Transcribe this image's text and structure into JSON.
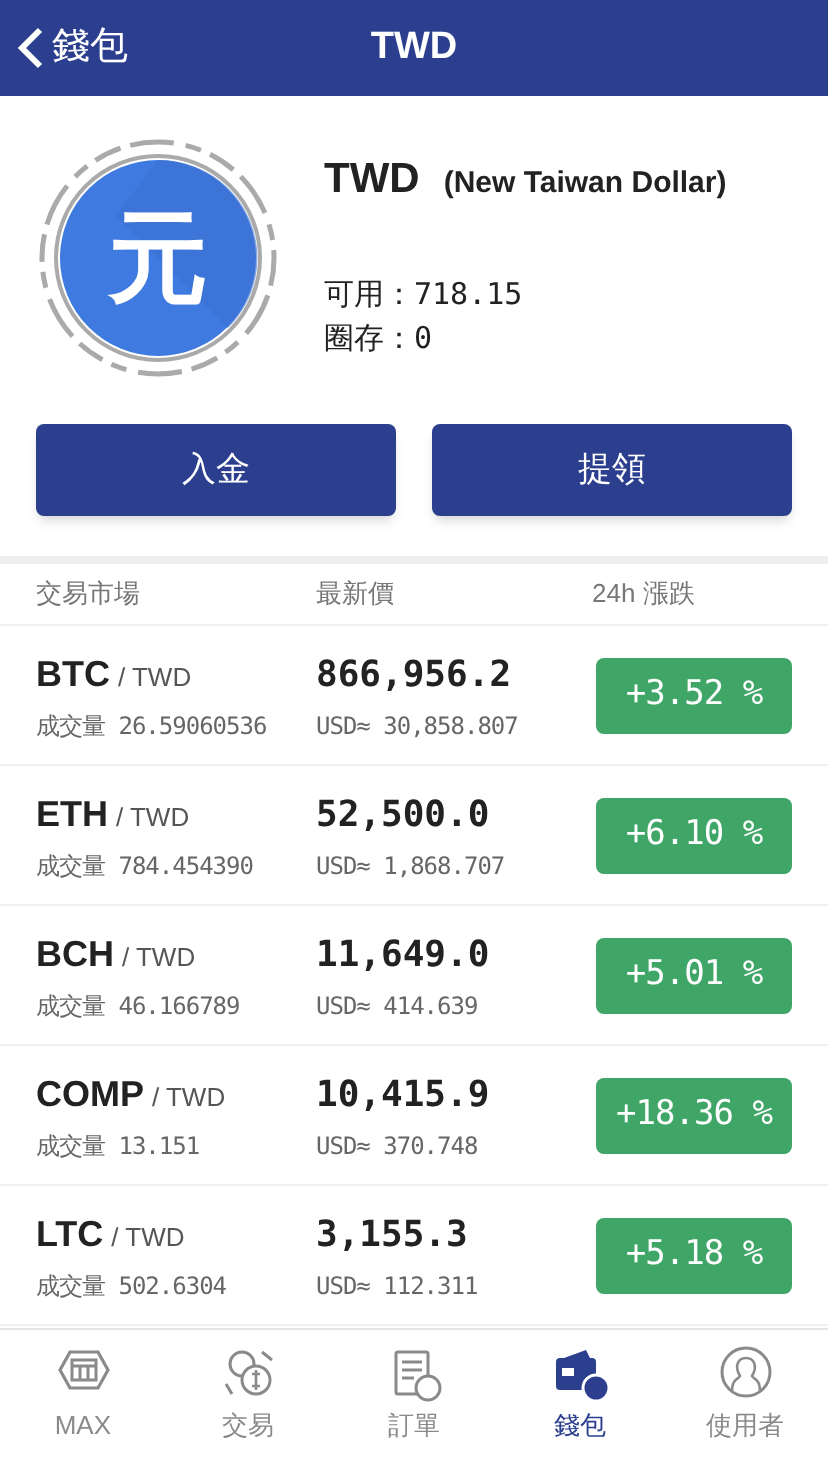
{
  "header": {
    "back_label": "錢包",
    "title": "TWD"
  },
  "currency": {
    "symbol": "元",
    "code": "TWD",
    "name": "(New Taiwan Dollar)",
    "available": "可用：718.15",
    "locked": "圈存：0"
  },
  "actions": [
    "入金",
    "提領"
  ],
  "table": {
    "columns": [
      "交易市場",
      "最新價",
      "24h 漲跌"
    ],
    "rows": [
      {
        "base": "BTC",
        "quote": "/ TWD",
        "volume": "成交量 26.59060536",
        "price": "866,956.2",
        "usd": "USD≈ 30,858.807",
        "change": "+3.52 %"
      },
      {
        "base": "ETH",
        "quote": "/ TWD",
        "volume": "成交量 784.454390",
        "price": "52,500.0",
        "usd": "USD≈ 1,868.707",
        "change": "+6.10 %"
      },
      {
        "base": "BCH",
        "quote": "/ TWD",
        "volume": "成交量 46.166789",
        "price": "11,649.0",
        "usd": "USD≈ 414.639",
        "change": "+5.01 %"
      },
      {
        "base": "COMP",
        "quote": "/ TWD",
        "volume": "成交量 13.151",
        "price": "10,415.9",
        "usd": "USD≈ 370.748",
        "change": "+18.36 %"
      },
      {
        "base": "LTC",
        "quote": "/ TWD",
        "volume": "成交量 502.6304",
        "price": "3,155.3",
        "usd": "USD≈ 112.311",
        "change": "+5.18 %"
      }
    ]
  },
  "tab_bar": [
    {
      "kind": "max",
      "label": "MAX",
      "selected": false
    },
    {
      "kind": "trade",
      "label": "交易",
      "selected": false
    },
    {
      "kind": "orders",
      "label": "訂單",
      "selected": false
    },
    {
      "kind": "wallet",
      "label": "錢包",
      "selected": true
    },
    {
      "kind": "user",
      "label": "使用者",
      "selected": false
    }
  ]
}
